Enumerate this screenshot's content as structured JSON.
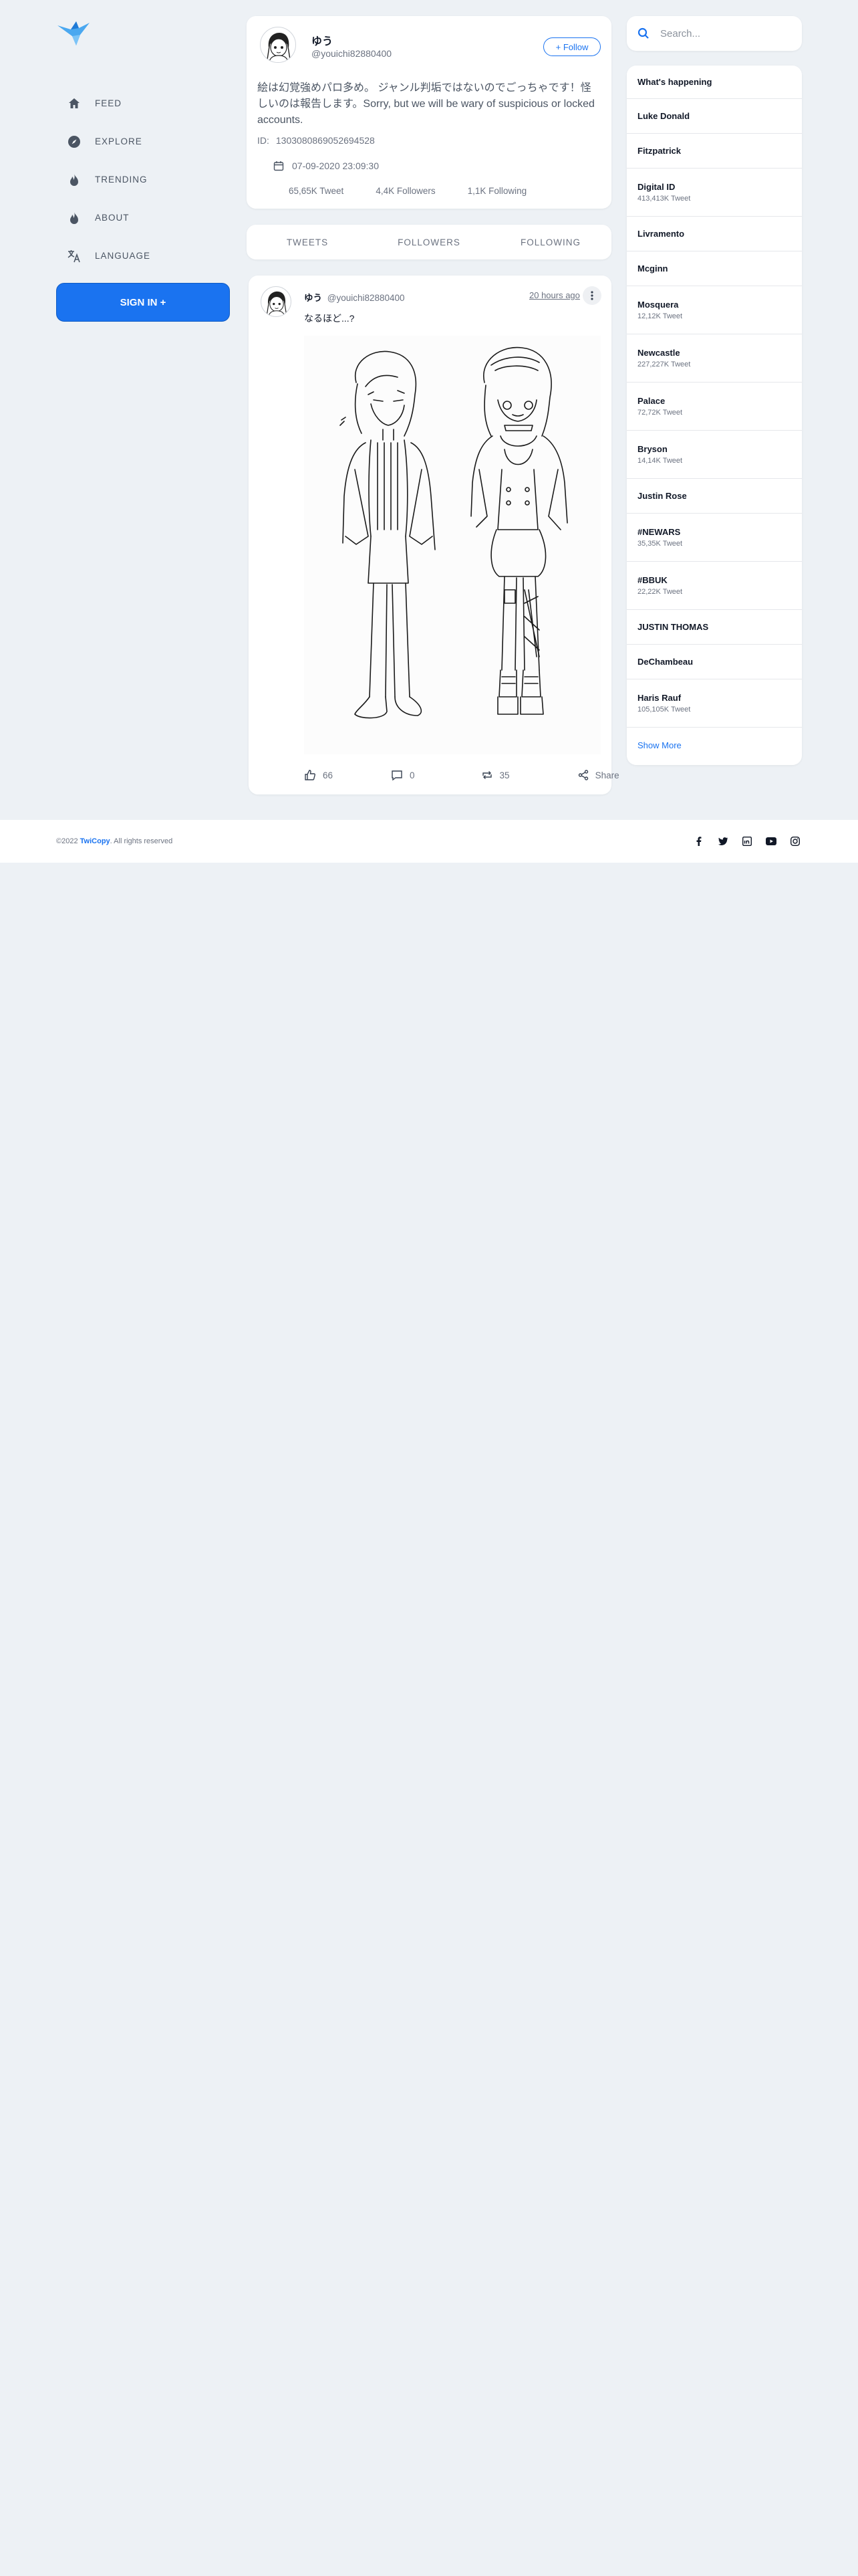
{
  "nav": {
    "items": [
      {
        "label": "FEED",
        "icon": "home-icon"
      },
      {
        "label": "EXPLORE",
        "icon": "compass-icon"
      },
      {
        "label": "TRENDING",
        "icon": "flame-icon"
      },
      {
        "label": "ABOUT",
        "icon": "flame-icon"
      },
      {
        "label": "LANGUAGE",
        "icon": "translate-icon"
      }
    ],
    "signin_label": "SIGN IN +"
  },
  "profile": {
    "name": "ゆう",
    "handle": "@youichi82880400",
    "follow_label": "+ Follow",
    "bio": "絵は幻覚強めパロ多め。 ジャンル判垢ではないのでごっちゃです！怪しいのは報告します。Sorry, but we will be wary of suspicious or locked accounts.",
    "id_label": "ID:",
    "id_value": "1303080869052694528",
    "joined": "07-09-2020 23:09:30",
    "stats": {
      "tweets": "65,65K Tweet",
      "followers": "4,4K Followers",
      "following": "1,1K Following"
    }
  },
  "tabs": [
    "TWEETS",
    "FOLLOWERS",
    "FOLLOWING"
  ],
  "tweet": {
    "name": "ゆう",
    "handle": "@youichi82880400",
    "time": "20 hours ago",
    "text": "なるほど...?",
    "likes": "66",
    "comments": "0",
    "retweets": "35",
    "share_label": "Share"
  },
  "search": {
    "placeholder": "Search..."
  },
  "trends": {
    "header": "What's happening",
    "items": [
      {
        "name": "Luke Donald",
        "count": ""
      },
      {
        "name": "Fitzpatrick",
        "count": ""
      },
      {
        "name": "Digital ID",
        "count": "413,413K Tweet"
      },
      {
        "name": "Livramento",
        "count": ""
      },
      {
        "name": "Mcginn",
        "count": ""
      },
      {
        "name": "Mosquera",
        "count": "12,12K Tweet"
      },
      {
        "name": "Newcastle",
        "count": "227,227K Tweet"
      },
      {
        "name": "Palace",
        "count": "72,72K Tweet"
      },
      {
        "name": "Bryson",
        "count": "14,14K Tweet"
      },
      {
        "name": "Justin Rose",
        "count": ""
      },
      {
        "name": "#NEWARS",
        "count": "35,35K Tweet"
      },
      {
        "name": "#BBUK",
        "count": "22,22K Tweet"
      },
      {
        "name": "JUSTIN THOMAS",
        "count": ""
      },
      {
        "name": "DeChambeau",
        "count": ""
      },
      {
        "name": "Haris Rauf",
        "count": "105,105K Tweet"
      }
    ],
    "show_more": "Show More"
  },
  "footer": {
    "copyright_prefix": "©2022",
    "brand": "TwiCopy",
    "copyright_suffix": ". All rights reserved",
    "social": [
      "facebook-icon",
      "twitter-icon",
      "linkedin-icon",
      "youtube-icon",
      "instagram-icon"
    ]
  },
  "colors": {
    "accent": "#1a73f0",
    "background": "#edf1f5"
  }
}
